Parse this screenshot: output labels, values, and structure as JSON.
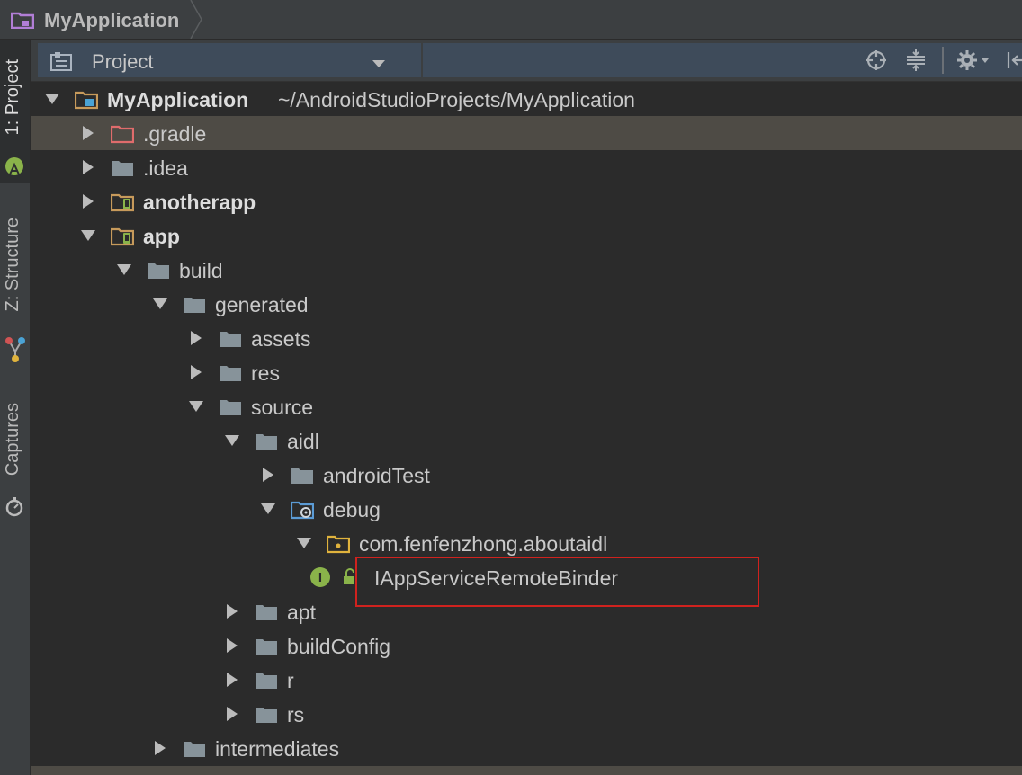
{
  "breadcrumb": {
    "project_name": "MyApplication"
  },
  "tool_strip": {
    "tabs": [
      {
        "label": "1: Project",
        "icon": "android-icon"
      },
      {
        "label": "Z: Structure",
        "icon": "structure-icon"
      },
      {
        "label": "Captures",
        "icon": "captures-icon"
      }
    ]
  },
  "panel_header": {
    "view_label": "Project",
    "buttons": [
      "locate-icon",
      "collapse-all-icon",
      "gear-icon",
      "hide-panel-icon"
    ]
  },
  "colors": {
    "background": "#2b2b2b",
    "selection": "#4e4b45",
    "folder": "#87939a",
    "highlight_box": "#d0221e",
    "interface_badge": "#8ab34a"
  },
  "tree": [
    {
      "label": "MyApplication",
      "path": "~/AndroidStudioProjects/MyApplication",
      "depth": 0,
      "state": "expanded",
      "icon": "project-folder-icon",
      "bold": true
    },
    {
      "label": ".gradle",
      "depth": 1,
      "state": "collapsed",
      "icon": "excluded-folder-icon",
      "selected": true
    },
    {
      "label": ".idea",
      "depth": 1,
      "state": "collapsed",
      "icon": "folder-icon"
    },
    {
      "label": "anotherapp",
      "depth": 1,
      "state": "collapsed",
      "icon": "module-folder-icon",
      "bold": true
    },
    {
      "label": "app",
      "depth": 1,
      "state": "expanded",
      "icon": "module-folder-icon",
      "bold": true
    },
    {
      "label": "build",
      "depth": 2,
      "state": "expanded",
      "icon": "folder-icon"
    },
    {
      "label": "generated",
      "depth": 3,
      "state": "expanded",
      "icon": "folder-icon"
    },
    {
      "label": "assets",
      "depth": 4,
      "state": "collapsed",
      "icon": "folder-icon"
    },
    {
      "label": "res",
      "depth": 4,
      "state": "collapsed",
      "icon": "folder-icon"
    },
    {
      "label": "source",
      "depth": 4,
      "state": "expanded",
      "icon": "folder-icon"
    },
    {
      "label": "aidl",
      "depth": 5,
      "state": "expanded",
      "icon": "folder-icon"
    },
    {
      "label": "androidTest",
      "depth": 6,
      "state": "collapsed",
      "icon": "folder-icon"
    },
    {
      "label": "debug",
      "depth": 6,
      "state": "expanded",
      "icon": "source-root-folder-icon"
    },
    {
      "label": "com.fenfenzhong.aboutaidl",
      "depth": 7,
      "state": "expanded",
      "icon": "package-icon"
    },
    {
      "label": "IAppServiceRemoteBinder",
      "depth": 8,
      "state": "leaf",
      "icon": "interface-icon"
    },
    {
      "label": "apt",
      "depth": 5,
      "state": "collapsed",
      "icon": "folder-icon"
    },
    {
      "label": "buildConfig",
      "depth": 5,
      "state": "collapsed",
      "icon": "folder-icon"
    },
    {
      "label": "r",
      "depth": 5,
      "state": "collapsed",
      "icon": "folder-icon"
    },
    {
      "label": "rs",
      "depth": 5,
      "state": "collapsed",
      "icon": "folder-icon"
    },
    {
      "label": "intermediates",
      "depth": 3,
      "state": "collapsed",
      "icon": "folder-icon"
    }
  ]
}
